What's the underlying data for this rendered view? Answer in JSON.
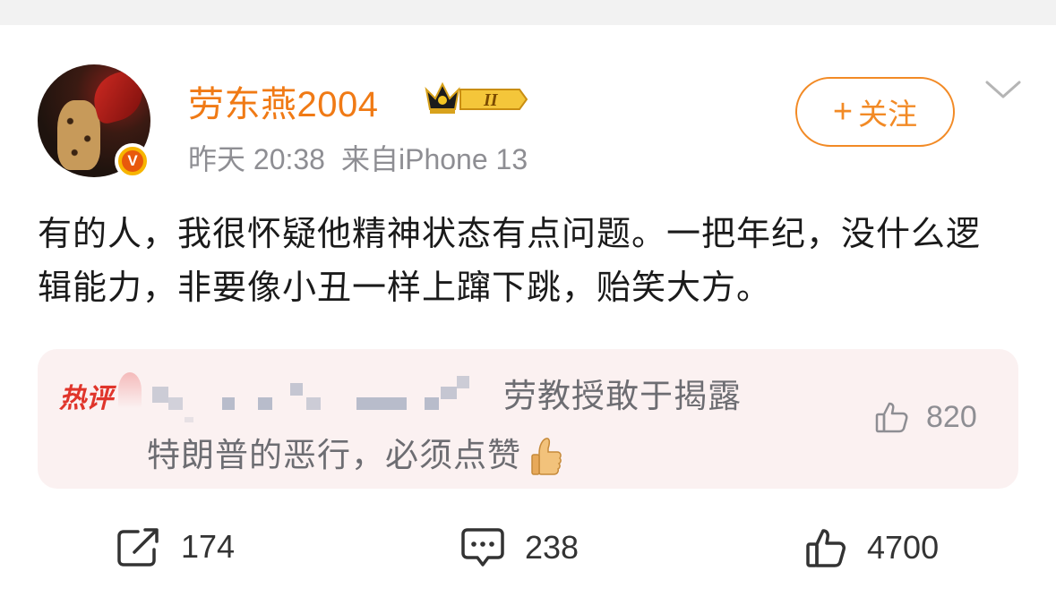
{
  "post": {
    "username": "劳东燕2004",
    "verified_badge": "V",
    "rank_badge": "II",
    "time": "昨天 20:38",
    "source": "来自iPhone 13",
    "follow_label": "关注",
    "text": "有的人，我很怀疑他精神状态有点问题。一把年纪，没什么逻辑能力，非要像小丑一样上蹿下跳，贻笑大方。"
  },
  "hot_comment": {
    "tag": "热评",
    "line1": "劳教授敢于揭露",
    "line2": "特朗普的恶行，必须点赞",
    "likes": "820"
  },
  "actions": {
    "reposts": "174",
    "comments": "238",
    "likes": "4700"
  },
  "icons": {
    "follow": "plus-icon",
    "menu": "chevron-down-icon",
    "repost": "share-icon",
    "comment": "comment-bubble-icon",
    "like": "thumbs-up-icon"
  },
  "colors": {
    "username": "#f07a15",
    "follow": "#f28a25",
    "hot_tag": "#e0352b",
    "hot_comment_bg": "#fbf1f1",
    "meta": "#8e8e93"
  }
}
